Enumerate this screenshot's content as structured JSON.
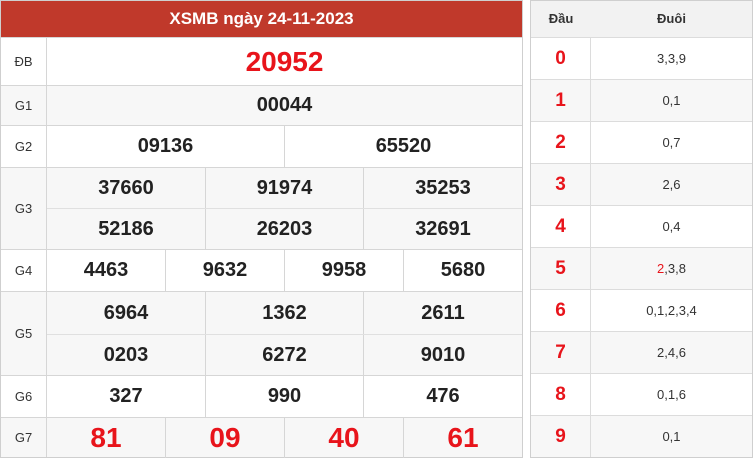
{
  "title": "XSMB ngày 24-11-2023",
  "results": {
    "db": {
      "label": "ĐB",
      "values": [
        "20952"
      ]
    },
    "g1": {
      "label": "G1",
      "values": [
        "00044"
      ]
    },
    "g2": {
      "label": "G2",
      "values": [
        "09136",
        "65520"
      ]
    },
    "g3": {
      "label": "G3",
      "values": [
        "37660",
        "91974",
        "35253",
        "52186",
        "26203",
        "32691"
      ]
    },
    "g4": {
      "label": "G4",
      "values": [
        "4463",
        "9632",
        "9958",
        "5680"
      ]
    },
    "g5": {
      "label": "G5",
      "values": [
        "6964",
        "1362",
        "2611",
        "0203",
        "6272",
        "9010"
      ]
    },
    "g6": {
      "label": "G6",
      "values": [
        "327",
        "990",
        "476"
      ]
    },
    "g7": {
      "label": "G7",
      "values": [
        "81",
        "09",
        "40",
        "61"
      ]
    }
  },
  "dau_duoi": {
    "head_dau": "Đầu",
    "head_duoi": "Đuôi",
    "rows": [
      {
        "dau": "0",
        "duoi": "3,3,9"
      },
      {
        "dau": "1",
        "duoi": "0,1"
      },
      {
        "dau": "2",
        "duoi": "0,7"
      },
      {
        "dau": "3",
        "duoi": "2,6"
      },
      {
        "dau": "4",
        "duoi": "0,4"
      },
      {
        "dau": "5",
        "duoi_highlight": "2",
        "duoi": ",3,8"
      },
      {
        "dau": "6",
        "duoi": "0,1,2,3,4"
      },
      {
        "dau": "7",
        "duoi": "2,4,6"
      },
      {
        "dau": "8",
        "duoi": "0,1,6"
      },
      {
        "dau": "9",
        "duoi": "0,1"
      }
    ]
  },
  "colors": {
    "header_bg": "#c0392b",
    "highlight": "#e8141b"
  }
}
